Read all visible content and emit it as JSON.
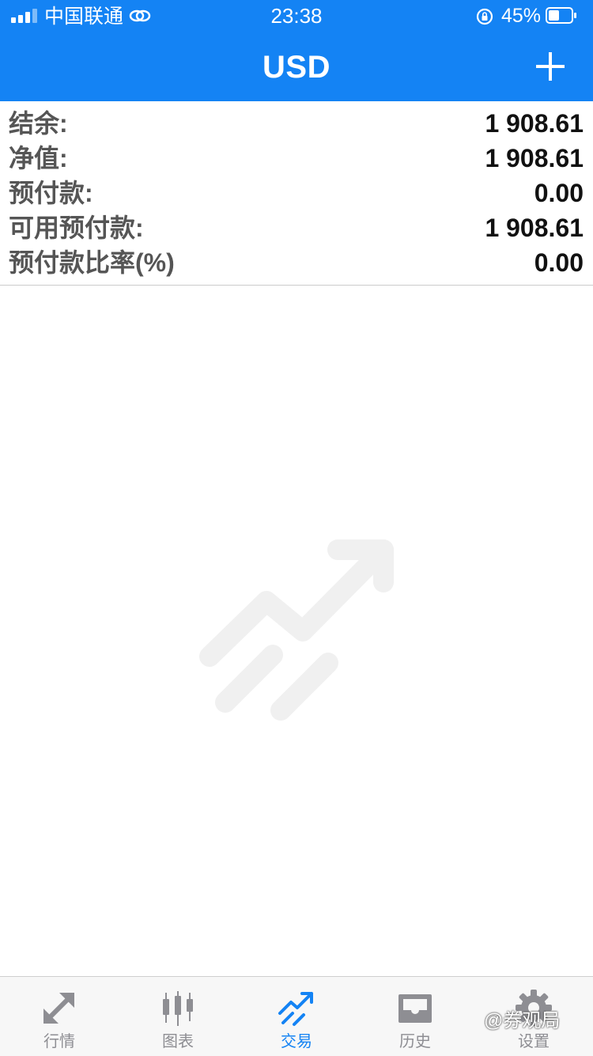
{
  "status_bar": {
    "carrier": "中国联通",
    "time": "23:38",
    "battery": "45%"
  },
  "header": {
    "title": "USD",
    "add_icon": "plus-icon"
  },
  "account": {
    "rows": [
      {
        "label": "结余:",
        "value": "1 908.61"
      },
      {
        "label": "净值:",
        "value": "1 908.61"
      },
      {
        "label": "预付款:",
        "value": "0.00"
      },
      {
        "label": "可用预付款:",
        "value": "1 908.61"
      },
      {
        "label": "预付款比率(%)",
        "value": "0.00"
      }
    ]
  },
  "empty_state": {
    "icon": "trade-placeholder-icon"
  },
  "tabs": [
    {
      "label": "行情",
      "icon": "quotes-icon",
      "active": false
    },
    {
      "label": "图表",
      "icon": "chart-icon",
      "active": false
    },
    {
      "label": "交易",
      "icon": "trade-icon",
      "active": true
    },
    {
      "label": "历史",
      "icon": "history-icon",
      "active": false
    },
    {
      "label": "设置",
      "icon": "settings-icon",
      "active": false
    }
  ],
  "watermark": "@券观局",
  "colors": {
    "accent": "#1483f4",
    "tab_inactive": "#8e8e93",
    "label_text": "#555555"
  }
}
